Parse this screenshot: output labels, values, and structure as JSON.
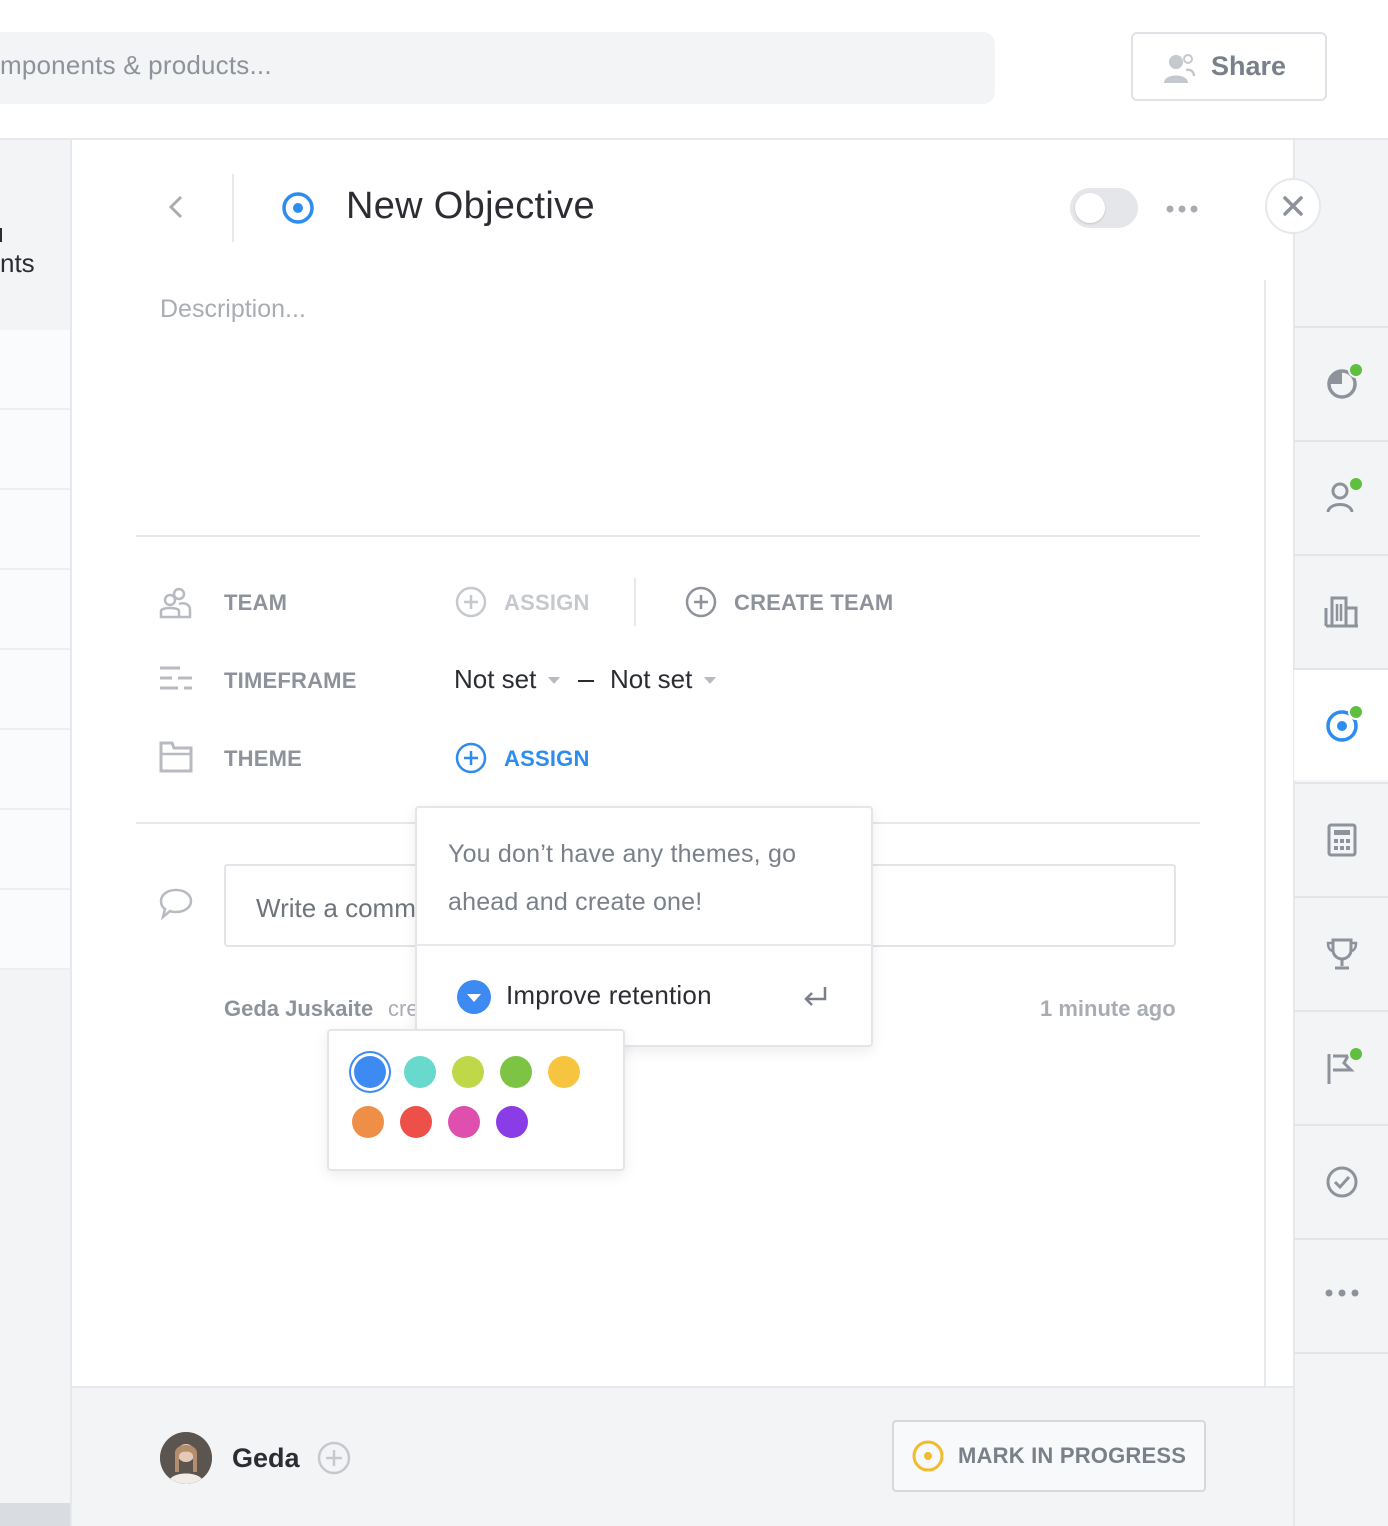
{
  "topbar": {
    "search_placeholder": "mponents & products...",
    "share_label": "Share"
  },
  "left_sidebar": {
    "partial_text": "nts"
  },
  "objective": {
    "title": "New Objective",
    "description_placeholder": "Description..."
  },
  "fields": {
    "team": {
      "label": "TEAM",
      "assign_label": "ASSIGN",
      "create_label": "CREATE TEAM"
    },
    "timeframe": {
      "label": "TIMEFRAME",
      "start": "Not set",
      "end": "Not set"
    },
    "theme": {
      "label": "THEME",
      "assign_label": "ASSIGN"
    }
  },
  "comment": {
    "placeholder": "Write a comm"
  },
  "activity": {
    "user": "Geda Juskaite",
    "action": "cre",
    "time": "1 minute ago"
  },
  "theme_popup": {
    "message": "You don’t have any themes, go ahead and create one!",
    "new_theme_name": "Improve retention",
    "new_theme_color": "#3d8bf2"
  },
  "color_picker": {
    "selected": "#3d8bf2",
    "colors": [
      "#3d8bf2",
      "#6ad9cd",
      "#bfd84a",
      "#7ec444",
      "#f7c43f",
      "#ef8f47",
      "#ec5049",
      "#de4fae",
      "#8a3ce6"
    ]
  },
  "right_rail": {
    "items": [
      "progress-icon",
      "person-icon",
      "building-icon",
      "objective-icon",
      "calculator-icon",
      "trophy-icon",
      "flag-icon",
      "check-icon",
      "more-icon"
    ],
    "active": "objective-icon"
  },
  "footer": {
    "owner_name": "Geda",
    "mark_label": "MARK IN PROGRESS"
  },
  "colors": {
    "accent": "#2d8cf0",
    "status_dot": "#5fbf3f",
    "in_progress": "#f3b92f"
  }
}
